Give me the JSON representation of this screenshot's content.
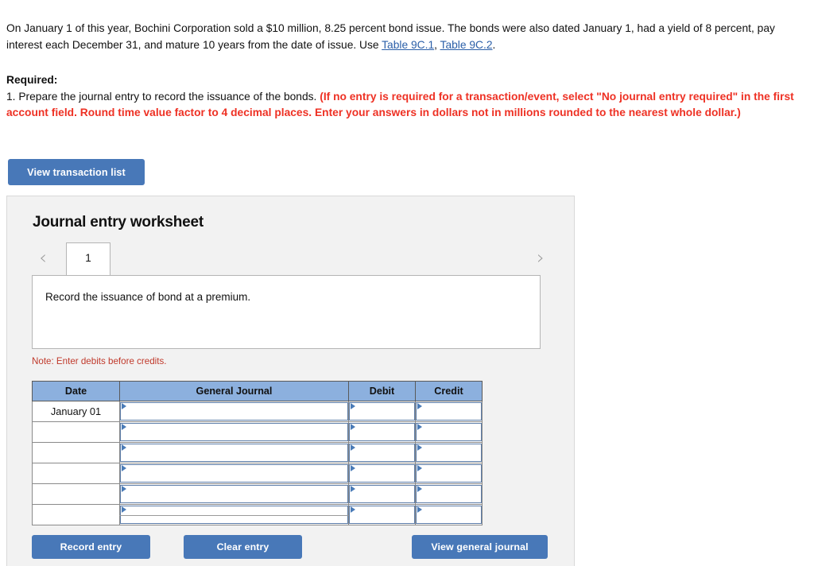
{
  "problem": {
    "text_part1": "On January 1 of this year, Bochini Corporation sold a $10 million, 8.25 percent bond issue. The bonds were also dated January 1, had a yield of 8 percent, pay interest each December 31, and mature 10 years from the date of issue. Use ",
    "link1": "Table 9C.1",
    "separator": ", ",
    "link2": "Table 9C.2",
    "text_end": "."
  },
  "required": {
    "label": "Required:",
    "item_normal": "1. Prepare the journal entry to record the issuance of the bonds. ",
    "item_red": "(If no entry is required for a transaction/event, select \"No journal entry required\" in the first account field. Round time value factor to 4 decimal places. Enter your answers in dollars not in millions rounded to the nearest whole dollar.)"
  },
  "toolbar": {
    "view_transaction_list_label": "View transaction list"
  },
  "worksheet": {
    "title": "Journal entry worksheet",
    "prev_arrow_glyph": "‹",
    "next_arrow_glyph": "›",
    "tabs": [
      {
        "label": "1",
        "active": true
      }
    ],
    "description": "Record the issuance of bond at a premium.",
    "note": "Note: Enter debits before credits.",
    "table": {
      "headers": [
        "Date",
        "General Journal",
        "Debit",
        "Credit"
      ],
      "rows": [
        {
          "date": "January 01",
          "general_journal": "",
          "debit": "",
          "credit": ""
        },
        {
          "date": "",
          "general_journal": "",
          "debit": "",
          "credit": ""
        },
        {
          "date": "",
          "general_journal": "",
          "debit": "",
          "credit": ""
        },
        {
          "date": "",
          "general_journal": "",
          "debit": "",
          "credit": ""
        },
        {
          "date": "",
          "general_journal": "",
          "debit": "",
          "credit": ""
        },
        {
          "date": "",
          "general_journal": "",
          "debit": "",
          "credit": ""
        }
      ]
    },
    "buttons": {
      "record_entry": "Record entry",
      "clear_entry": "Clear entry",
      "view_general_journal": "View general journal"
    }
  },
  "colors": {
    "button_blue": "#4878b8",
    "table_header_blue": "#8cb0de",
    "required_red": "#ee3124",
    "note_red": "#c0392b",
    "link_blue": "#2b5fa8",
    "panel_gray": "#f2f2f2"
  }
}
